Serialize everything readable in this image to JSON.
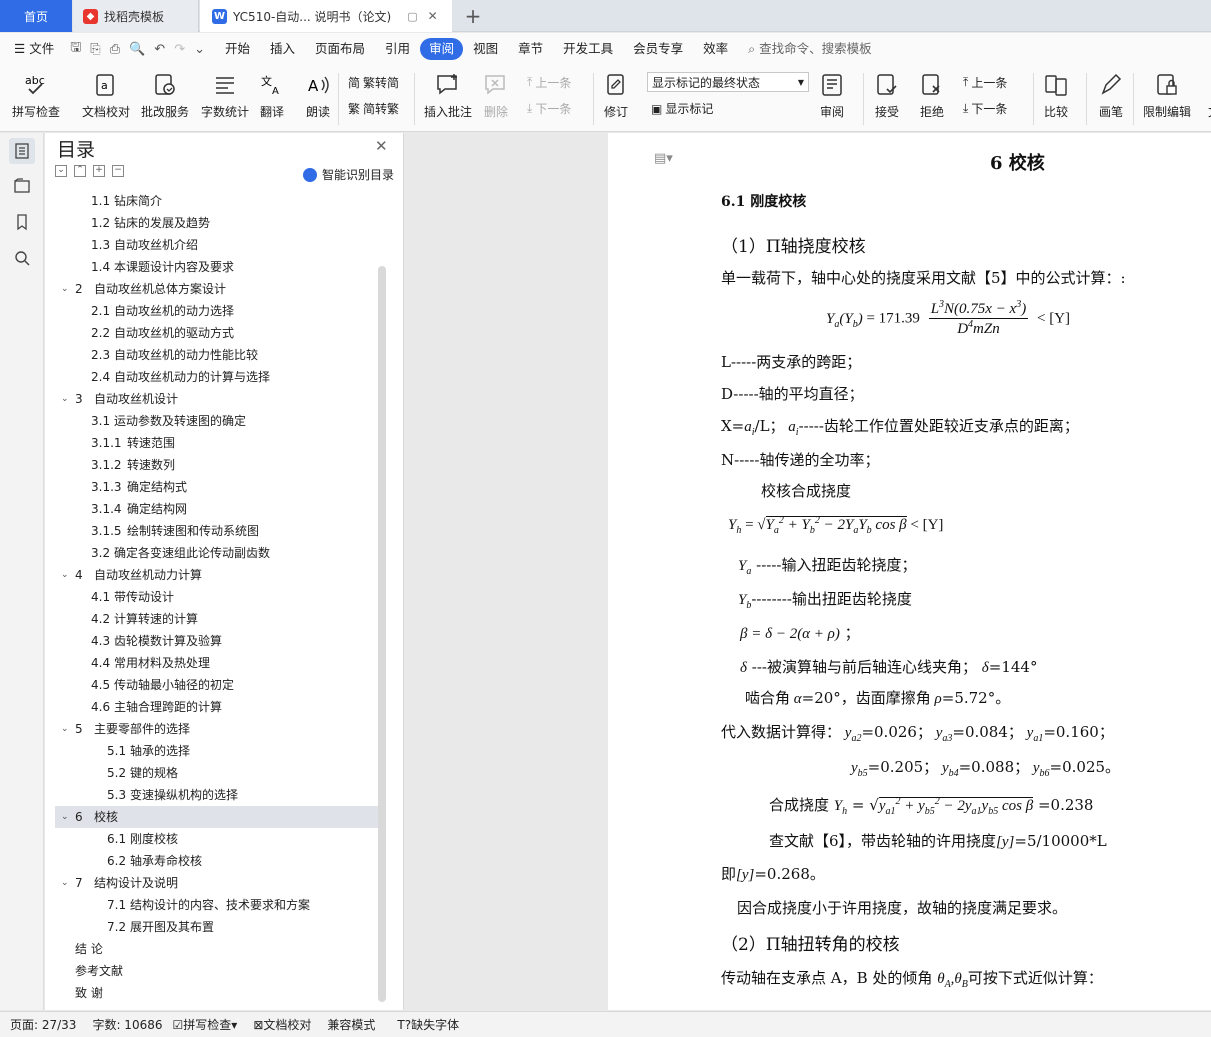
{
  "tabs": {
    "home": "首页",
    "template": "找稻壳模板",
    "doc": "YC510-自动... 说明书（论文)"
  },
  "menu": {
    "file": "文件",
    "items": [
      "开始",
      "插入",
      "页面布局",
      "引用",
      "审阅",
      "视图",
      "章节",
      "开发工具",
      "会员专享",
      "效率"
    ],
    "active": "审阅",
    "search": "查找命令、搜索模板"
  },
  "ribbon": {
    "spell": "拼写检查",
    "proof": "文档校对",
    "batch": "批改服务",
    "count": "字数统计",
    "translate": "翻译",
    "read": "朗读",
    "trad": "繁转简",
    "simp": "简转繁",
    "insert_comment": "插入批注",
    "delete": "删除",
    "prev": "上一条",
    "next": "下一条",
    "revise": "修订",
    "markup_select": "显示标记的最终状态",
    "show_markup": "显示标记",
    "review": "审阅",
    "accept": "接受",
    "reject": "拒绝",
    "prev2": "上一条",
    "next2": "下一条",
    "compare": "比较",
    "pen": "画笔",
    "restrict": "限制编辑",
    "doc_more": "文"
  },
  "toc": {
    "title": "目录",
    "smart": "智能识别目录",
    "items": [
      {
        "num": "1.1",
        "text": "钻床简介",
        "level": 2
      },
      {
        "num": "1.2",
        "text": "钻床的发展及趋势",
        "level": 2
      },
      {
        "num": "1.3",
        "text": "自动攻丝机介绍",
        "level": 2
      },
      {
        "num": "1.4",
        "text": "本课题设计内容及要求",
        "level": 2
      },
      {
        "num": "2",
        "text": "自动攻丝机总体方案设计",
        "level": 1
      },
      {
        "num": "2.1",
        "text": "自动攻丝机的动力选择",
        "level": 2
      },
      {
        "num": "2.2",
        "text": "自动攻丝机的驱动方式",
        "level": 2
      },
      {
        "num": "2.3",
        "text": "自动攻丝机的动力性能比较",
        "level": 2
      },
      {
        "num": "2.4",
        "text": "自动攻丝机动力的计算与选择",
        "level": 2
      },
      {
        "num": "3",
        "text": "自动攻丝机设计",
        "level": 1
      },
      {
        "num": "3.1",
        "text": "运动参数及转速图的确定",
        "level": 2
      },
      {
        "num": "3.1.1",
        "text": "转速范围",
        "level": 2
      },
      {
        "num": "3.1.2",
        "text": "转速数列",
        "level": 2
      },
      {
        "num": "3.1.3",
        "text": "确定结构式",
        "level": 2
      },
      {
        "num": "3.1.4",
        "text": "确定结构网",
        "level": 2
      },
      {
        "num": "3.1.5",
        "text": "绘制转速图和传动系统图",
        "level": 2
      },
      {
        "num": "3.2",
        "text": "确定各变速组此论传动副齿数",
        "level": 2
      },
      {
        "num": "4",
        "text": "自动攻丝机动力计算",
        "level": 1
      },
      {
        "num": "4.1",
        "text": "带传动设计",
        "level": 2
      },
      {
        "num": "4.2",
        "text": "计算转速的计算",
        "level": 2
      },
      {
        "num": "4.3",
        "text": "齿轮模数计算及验算",
        "level": 2
      },
      {
        "num": "4.4",
        "text": "常用材料及热处理",
        "level": 2
      },
      {
        "num": "4.5",
        "text": "传动轴最小轴径的初定",
        "level": 2
      },
      {
        "num": "4.6",
        "text": "主轴合理跨距的计算",
        "level": 2
      },
      {
        "num": "5",
        "text": "主要零部件的选择",
        "level": 1
      },
      {
        "num": "5.1",
        "text": "轴承的选择",
        "level": 3
      },
      {
        "num": "5.2",
        "text": "键的规格",
        "level": 3
      },
      {
        "num": "5.3",
        "text": "变速操纵机构的选择",
        "level": 3
      },
      {
        "num": "6",
        "text": "校核",
        "level": 1,
        "selected": true
      },
      {
        "num": "6.1",
        "text": "刚度校核",
        "level": 3
      },
      {
        "num": "6.2",
        "text": "轴承寿命校核",
        "level": 3
      },
      {
        "num": "7",
        "text": "结构设计及说明",
        "level": 1
      },
      {
        "num": "7.1",
        "text": "结构设计的内容、技术要求和方案",
        "level": 3
      },
      {
        "num": "7.2",
        "text": "展开图及其布置",
        "level": 3
      },
      {
        "num": "",
        "text": "结  论",
        "level": 0
      },
      {
        "num": "",
        "text": "参考文献",
        "level": 0
      },
      {
        "num": "",
        "text": "致    谢",
        "level": 0
      }
    ]
  },
  "doc": {
    "chapter": "6    校核",
    "section": "6.1  刚度校核",
    "sub1": "（1）Π轴挠度校核",
    "p1": "单一载荷下，轴中心处的挠度采用文献【5】中的公式计算：:",
    "l_def": "L-----两支承的跨距；",
    "d_def": "D-----轴的平均直径；",
    "x_def_tail": "-----齿轮工作位置处距较近支承点的距离；",
    "n_def": "N-----轴传递的全功率；",
    "combined": "校核合成挠度",
    "ya_def": "-----输入扭距齿轮挠度；",
    "yb_def": "--------输出扭距齿轮挠度",
    "delta_def": "---被演算轴与前后轴连心线夹角；",
    "delta_val": "=144°",
    "mesh": "啮合角",
    "alpha_val": "=20°，齿面摩擦角",
    "rho_val": "=5.72°。",
    "subst": "代入数据计算得：",
    "ya2": "=0.026；",
    "ya3": "=0.084；",
    "ya1": "=0.160；",
    "yb5": "=0.205；",
    "yb4": "=0.088；",
    "yb6": "=0.025。",
    "comb_lbl": "合成挠度",
    "comb_val": "=0.238",
    "lookup": "查文献【6】，带齿轮轴的许用挠度",
    "lookup_val": "=5/10000*L",
    "allow": "即",
    "allow_val": "=0.268。",
    "conclusion": "因合成挠度小于许用挠度，故轴的挠度满足要求。",
    "sub2": "（2）Π轴扭转角的校核",
    "p2": "传动轴在支承点 A，B 处的倾角",
    "p2_tail": "可按下式近似计算："
  },
  "status": {
    "page": "页面: 27/33",
    "words": "字数: 10686",
    "spell": "拼写检查",
    "proof": "文档校对",
    "compat": "兼容模式",
    "missing": "缺失字体"
  },
  "colors": {
    "accent": "#2f6ce6",
    "selected": "#dfe2e8"
  }
}
